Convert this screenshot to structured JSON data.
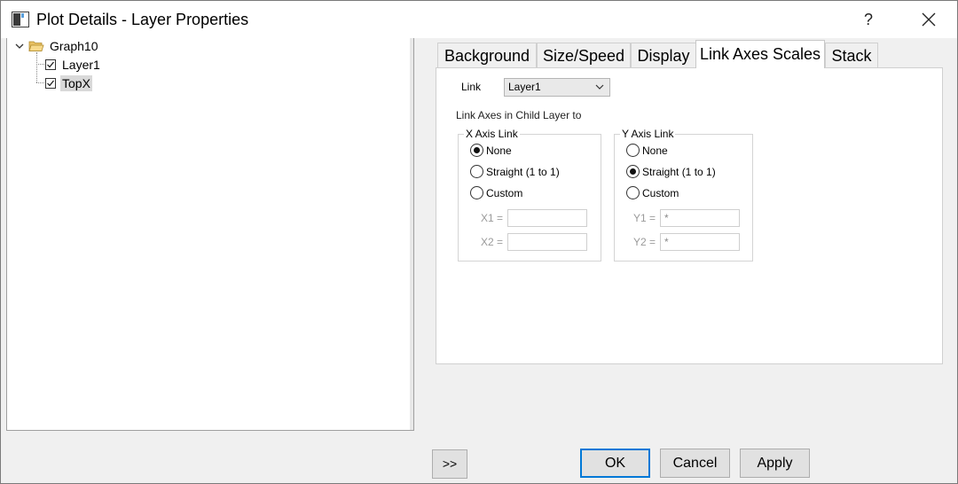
{
  "window": {
    "title": "Plot Details - Layer Properties",
    "help_label": "?",
    "close_icon": "close-icon"
  },
  "tree": {
    "root": {
      "label": "Graph10",
      "icon": "folder-open-icon",
      "expanded": true
    },
    "children": [
      {
        "label": "Layer1",
        "checked": true,
        "selected": false
      },
      {
        "label": "TopX",
        "checked": true,
        "selected": true
      }
    ]
  },
  "tabs": [
    {
      "label": "Background",
      "active": false
    },
    {
      "label": "Size/Speed",
      "active": false
    },
    {
      "label": "Display",
      "active": false
    },
    {
      "label": "Link Axes Scales",
      "active": true
    },
    {
      "label": "Stack",
      "active": false
    }
  ],
  "link_tab": {
    "link_label": "Link",
    "link_value": "Layer1",
    "child_label": "Link Axes in Child Layer to",
    "x_axis": {
      "title": "X Axis Link",
      "options": [
        "None",
        "Straight (1 to 1)",
        "Custom"
      ],
      "selected": "None",
      "x1_label": "X1 =",
      "x1_value": "",
      "x2_label": "X2 =",
      "x2_value": ""
    },
    "y_axis": {
      "title": "Y Axis Link",
      "options": [
        "None",
        "Straight (1 to 1)",
        "Custom"
      ],
      "selected": "Straight (1 to 1)",
      "y1_label": "Y1 =",
      "y1_value": "*",
      "y2_label": "Y2 =",
      "y2_value": "*"
    }
  },
  "buttons": {
    "expand": ">>",
    "ok": "OK",
    "cancel": "Cancel",
    "apply": "Apply"
  },
  "colors": {
    "accent": "#0078d7",
    "selection": "#d9d9d9"
  }
}
